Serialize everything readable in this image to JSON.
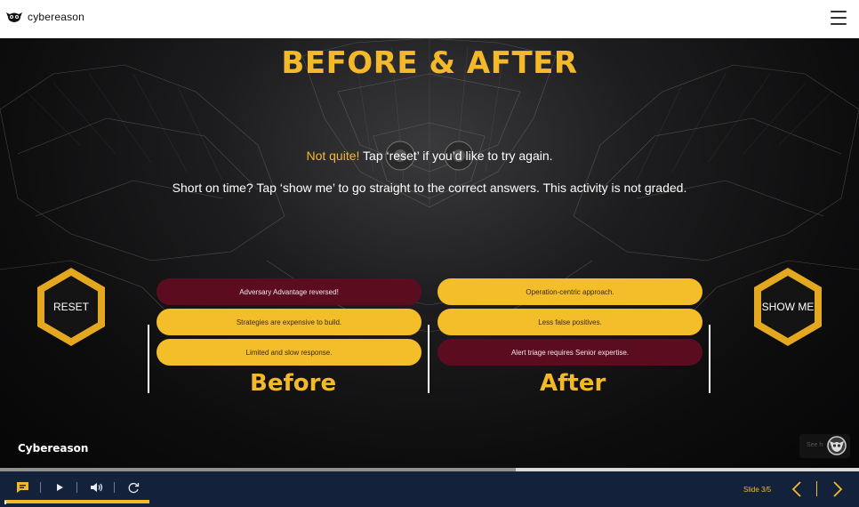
{
  "header": {
    "brand_name": "cybereason",
    "logo_icon": "owl-logo-icon",
    "menu_icon": "hamburger-menu-icon"
  },
  "slide": {
    "title": "BEFORE & AFTER",
    "feedback_highlight": "Not quite!",
    "feedback_rest": " Tap ‘reset’ if you’d like to try again.",
    "instruction": "Short on time? Tap ‘show me’ to go straight to the correct answers. This activity is not graded.",
    "reset_label": "RESET",
    "show_me_label": "SHOW ME",
    "before_label": "Before",
    "after_label": "After",
    "before_items": [
      {
        "text": "Adversary Advantage reversed!",
        "state": "incorrect"
      },
      {
        "text": "Strategies are expensive to build.",
        "state": "correct"
      },
      {
        "text": "Limited and slow response.",
        "state": "correct"
      }
    ],
    "after_items": [
      {
        "text": "Operation-centric approach.",
        "state": "correct"
      },
      {
        "text": "Less false positives.",
        "state": "correct"
      },
      {
        "text": "Alert triage requires Senior expertise.",
        "state": "incorrect"
      }
    ],
    "footer_brand": "Cybereason",
    "corner_widget_text": "See h"
  },
  "player": {
    "transcript_icon": "transcript-icon",
    "play_icon": "play-icon",
    "volume_icon": "volume-icon",
    "replay_icon": "replay-icon",
    "slide_counter": "Slide 3/5",
    "prev_icon": "chevron-left-icon",
    "next_icon": "chevron-right-icon",
    "progress": 0.6
  },
  "colors": {
    "accent": "#f4b92a",
    "incorrect": "#5b0d1f",
    "player_bg": "#13223a"
  }
}
